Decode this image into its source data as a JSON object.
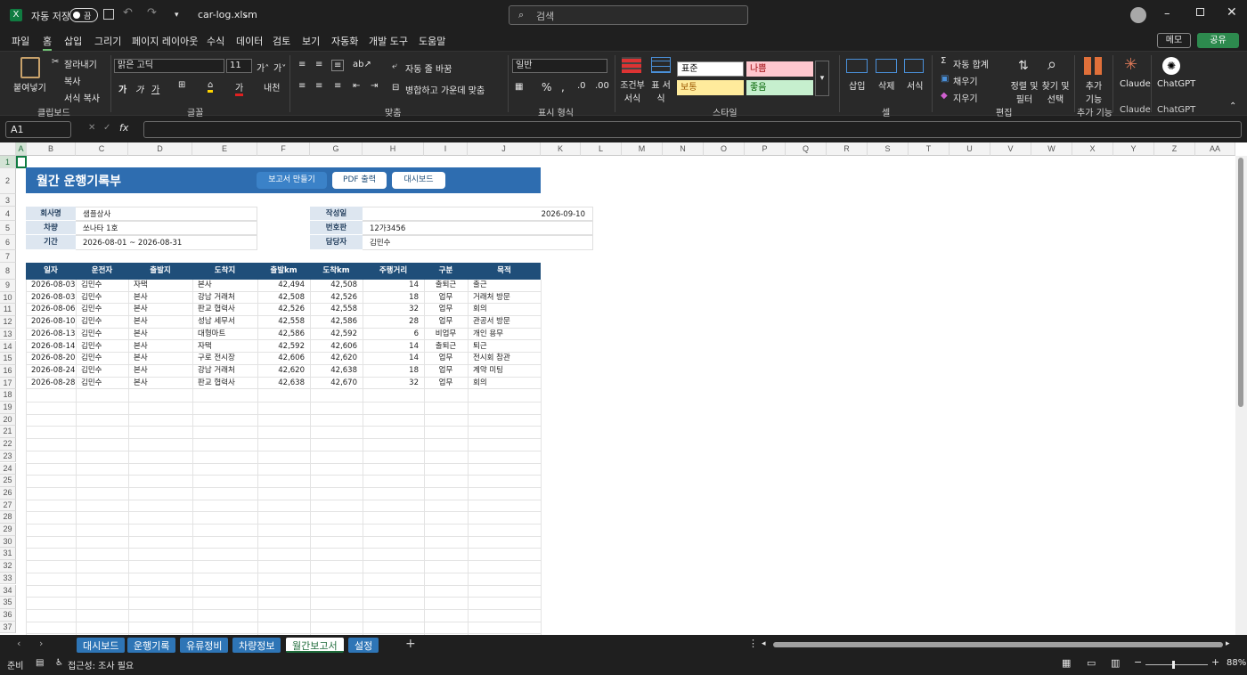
{
  "titlebar": {
    "autosave_label": "자동 저장",
    "toggle_state": "끔",
    "filename": "car-log.xlsm",
    "search_placeholder": "검색"
  },
  "menu": [
    "파일",
    "홈",
    "삽입",
    "그리기",
    "페이지 레이아웃",
    "수식",
    "데이터",
    "검토",
    "보기",
    "자동화",
    "개발 도구",
    "도움말"
  ],
  "menu_active": "홈",
  "memo_label": "메모",
  "share_label": "공유",
  "ribbon": {
    "paste": "붙여넣기",
    "cut": "잘라내기",
    "copy": "복사",
    "format_painter": "서식 복사",
    "clipboard_label": "클립보드",
    "font_name": "맑은 고딕",
    "font_size": "11",
    "font_label": "글꼴",
    "wrap_text": "자동 줄 바꿈",
    "merge_center": "병합하고 가운데 맞춤",
    "align_label": "맞춤",
    "number_format": "일반",
    "number_label": "표시 형식",
    "cond_format": "조건부 서식",
    "table_format": "표 서식",
    "styles": {
      "normal": "표준",
      "bad": "나쁨",
      "neutral": "보통",
      "good": "좋음"
    },
    "styles_label": "스타일",
    "insert": "삽입",
    "delete": "삭제",
    "format": "서식",
    "cells_label": "셀",
    "autosum": "자동 합계",
    "fill": "채우기",
    "clear": "지우기",
    "sort_filter": "정렬 및 필터",
    "find_select": "찾기 및 선택",
    "edit_label": "편집",
    "addins": "추가 기능",
    "addins_label": "추가 기능",
    "claude": "Claude",
    "claude_label": "Claude",
    "chatgpt": "ChatGPT",
    "chatgpt_label": "ChatGPT"
  },
  "formula": {
    "namebox": "A1",
    "content": ""
  },
  "columns": [
    "A",
    "B",
    "C",
    "D",
    "E",
    "F",
    "G",
    "H",
    "I",
    "J",
    "K",
    "L",
    "M",
    "N",
    "O",
    "P",
    "Q",
    "R",
    "S",
    "T",
    "U",
    "V",
    "W",
    "X",
    "Y",
    "Z",
    "AA"
  ],
  "report": {
    "title": "월간 운행기록부",
    "buttons": [
      "보고서 만들기",
      "PDF 출력",
      "대시보드"
    ],
    "info_left": [
      [
        "회사명",
        "샘플상사"
      ],
      [
        "차량",
        "쏘나타 1호"
      ],
      [
        "기간",
        "2026-08-01 ~ 2026-08-31"
      ]
    ],
    "info_right": [
      [
        "작성일",
        "2026-09-10"
      ],
      [
        "번호판",
        "12가3456"
      ],
      [
        "담당자",
        "김민수"
      ]
    ],
    "headers": [
      "일자",
      "운전자",
      "출발지",
      "도착지",
      "출발km",
      "도착km",
      "주행거리",
      "구분",
      "목적"
    ],
    "rows": [
      [
        "2026-08-03",
        "김민수",
        "자택",
        "본사",
        "42,494",
        "42,508",
        "14",
        "출퇴근",
        "출근"
      ],
      [
        "2026-08-03",
        "김민수",
        "본사",
        "강남 거래처",
        "42,508",
        "42,526",
        "18",
        "업무",
        "거래처 방문"
      ],
      [
        "2026-08-06",
        "김민수",
        "본사",
        "판교 협력사",
        "42,526",
        "42,558",
        "32",
        "업무",
        "회의"
      ],
      [
        "2026-08-10",
        "김민수",
        "본사",
        "성남 세무서",
        "42,558",
        "42,586",
        "28",
        "업무",
        "관공서 방문"
      ],
      [
        "2026-08-13",
        "김민수",
        "본사",
        "대형마트",
        "42,586",
        "42,592",
        "6",
        "비업무",
        "개인 용무"
      ],
      [
        "2026-08-14",
        "김민수",
        "본사",
        "자택",
        "42,592",
        "42,606",
        "14",
        "출퇴근",
        "퇴근"
      ],
      [
        "2026-08-20",
        "김민수",
        "본사",
        "구로 전시장",
        "42,606",
        "42,620",
        "14",
        "업무",
        "전시회 참관"
      ],
      [
        "2026-08-24",
        "김민수",
        "본사",
        "강남 거래처",
        "42,620",
        "42,638",
        "18",
        "업무",
        "계약 미팅"
      ],
      [
        "2026-08-28",
        "김민수",
        "본사",
        "판교 협력사",
        "42,638",
        "42,670",
        "32",
        "업무",
        "회의"
      ]
    ]
  },
  "sheet_tabs": [
    "대시보드",
    "운행기록",
    "유류정비",
    "차량정보",
    "월간보고서",
    "설정"
  ],
  "active_tab": "월간보고서",
  "status": {
    "ready": "준비",
    "accessibility": "접근성: 조사 필요",
    "zoom": "88%"
  }
}
